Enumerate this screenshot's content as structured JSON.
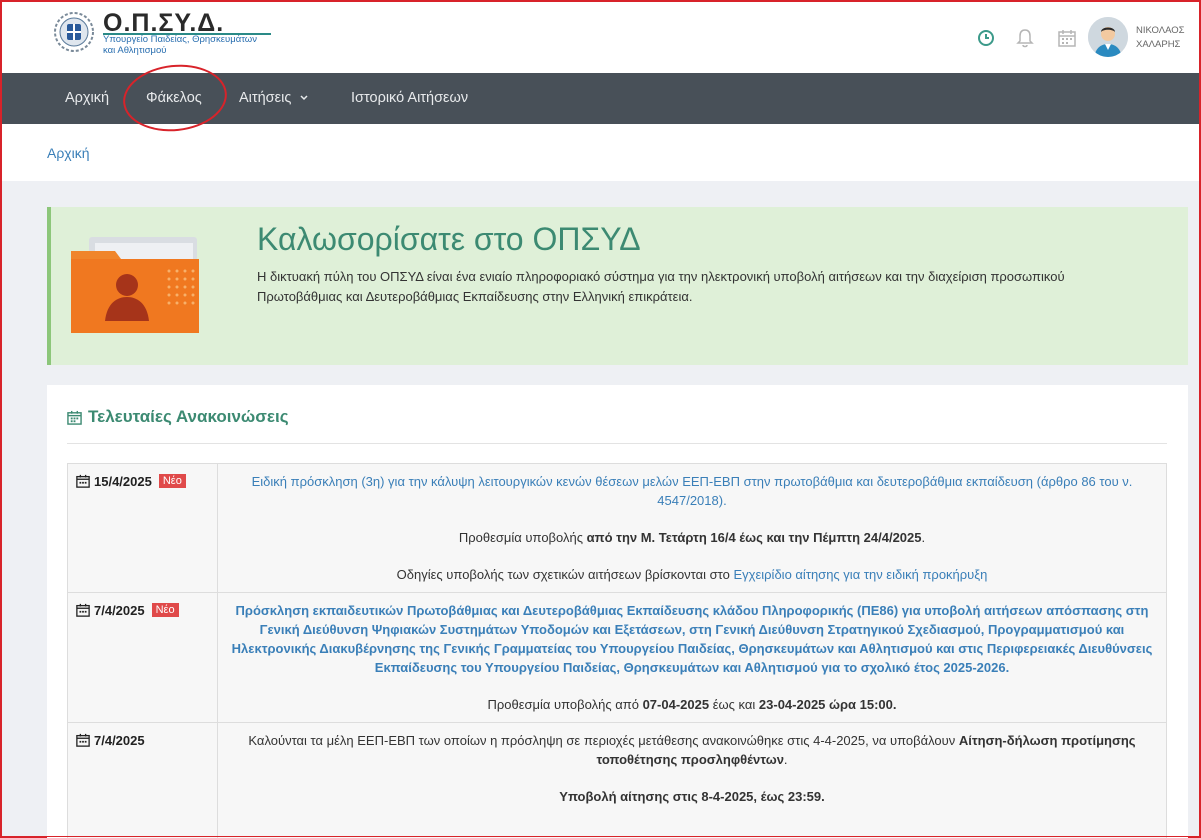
{
  "header": {
    "brand": "Ο.Π.ΣΥ.Δ.",
    "brand_sub1": "Υπουργείο Παιδείας, Θρησκευμάτων",
    "brand_sub2": "και Αθλητισμού",
    "user_first": "ΝΙΚΟΛΑΟΣ",
    "user_last": "ΧΑΛΑΡΗΣ"
  },
  "nav": {
    "home": "Αρχική",
    "folder": "Φάκελος",
    "requests": "Αιτήσεις",
    "history": "Ιστορικό Αιτήσεων"
  },
  "breadcrumb": {
    "home": "Αρχική"
  },
  "welcome": {
    "title": "Καλωσορίσατε στο ΟΠΣΥΔ",
    "text": "Η δικτυακή πύλη του ΟΠΣΥΔ είναι ένα ενιαίο πληροφοριακό σύστημα για την ηλεκτρονική υποβολή αιτήσεων και την διαχείριση προσωπικού Πρωτοβάθμιας και Δευτεροβάθμιας Εκπαίδευσης στην Ελληνική επικράτεια."
  },
  "announcements": {
    "title": "Τελευταίες Ανακοινώσεις",
    "new_badge": "Νέο",
    "items": [
      {
        "date": "15/4/2025",
        "link": "Ειδική πρόσκληση (3η) για την κάλυψη λειτουργικών κενών θέσεων μελών ΕΕΠ-ΕΒΠ στην πρωτοβάθμια και δευτεροβάθμια εκπαίδευση (άρθρο 86 του ν. 4547/2018).",
        "deadline_prefix": "Προθεσμία υποβολής",
        "deadline_bold": "από την Μ. Τετάρτη 16/4 έως και την Πέμπτη 24/4/2025",
        "deadline_suffix": ".",
        "guide_prefix": "Οδηγίες υποβολής των σχετικών αιτήσεων βρίσκονται στο",
        "guide_link": "Εγχειρίδιο αίτησης για την ειδική προκήρυξη"
      },
      {
        "date": "7/4/2025",
        "link": "Πρόσκληση εκπαιδευτικών Πρωτοβάθμιας και Δευτεροβάθμιας Εκπαίδευσης κλάδου Πληροφορικής (ΠΕ86) για υποβολή αιτήσεων απόσπασης στη Γενική Διεύθυνση Ψηφιακών Συστημάτων Υποδομών και Εξετάσεων, στη Γενική Διεύθυνση Στρατηγικού Σχεδιασμού, Προγραμματισμού και Ηλεκτρονικής Διακυβέρνησης της Γενικής Γραμματείας του Υπουργείου Παιδείας, Θρησκευμάτων και Αθλητισμού και στις Περιφερειακές Διευθύνσεις Εκπαίδευσης του Υπουργείου Παιδείας, Θρησκευμάτων και Αθλητισμού για το σχολικό έτος 2025-2026.",
        "deadline_prefix": "Προθεσμία υποβολής από",
        "deadline_from": "07-04-2025",
        "deadline_mid": "έως και",
        "deadline_to": "23-04-2025 ώρα 15:00."
      },
      {
        "date": "7/4/2025",
        "text_prefix": "Καλούνται τα μέλη ΕΕΠ-ΕΒΠ των οποίων η πρόσληψη σε περιοχές μετάθεσης ανακοινώθηκε στις 4-4-2025, να υποβάλουν",
        "text_bold": "Αίτηση-δήλωση προτίμησης τοποθέτησης προσληφθέντων",
        "text_suffix": ".",
        "submission": "Υποβολή αίτησης στις 8-4-2025, έως 23:59."
      }
    ]
  },
  "colors": {
    "nav_bg": "#485058",
    "accent_green": "#3c8a72",
    "link_blue": "#3a7fb8",
    "welcome_bg": "#dff0d8",
    "badge_red": "#e04a4a"
  }
}
